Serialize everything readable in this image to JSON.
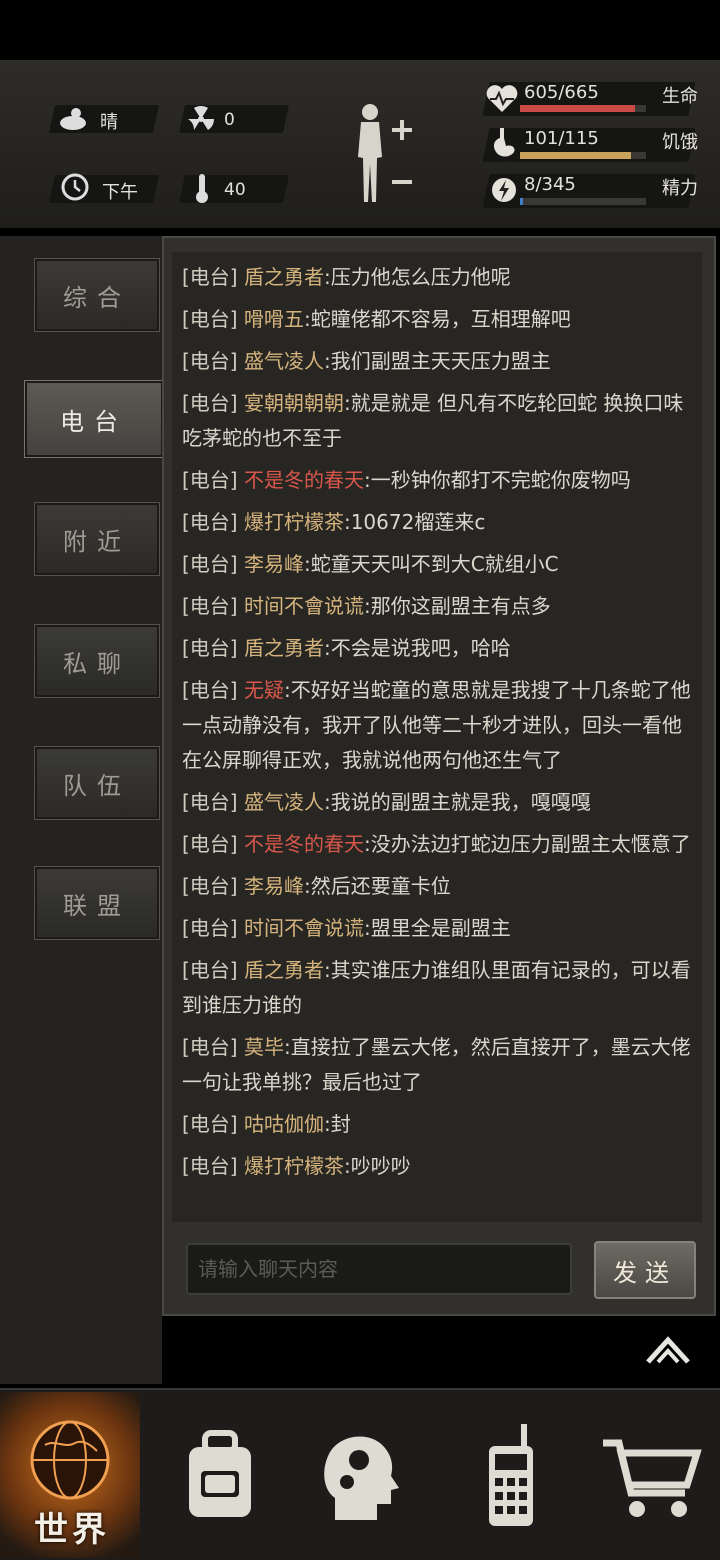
{
  "hud": {
    "weather": "晴",
    "radiation": "0",
    "time_of_day": "下午",
    "temperature": "40",
    "health": {
      "label": "生命",
      "value": "605/665",
      "fraction": 0.91,
      "color": "#c84a45"
    },
    "hunger": {
      "label": "饥饿",
      "value": "101/115",
      "fraction": 0.88,
      "color": "#c9a25b"
    },
    "energy": {
      "label": "精力",
      "value": "8/345",
      "fraction": 0.02,
      "color": "#3f7fcf"
    }
  },
  "tabs": [
    {
      "label": "综合",
      "active": false
    },
    {
      "label": "电台",
      "active": true
    },
    {
      "label": "附近",
      "active": false
    },
    {
      "label": "私聊",
      "active": false
    },
    {
      "label": "队伍",
      "active": false
    },
    {
      "label": "联盟",
      "active": false
    }
  ],
  "messages": [
    {
      "channel": "[电台]",
      "name": "盾之勇者",
      "text": ":压力他怎么压力他呢",
      "red": false
    },
    {
      "channel": "[电台]",
      "name": "嗗嗗五",
      "text": ":蛇瞳佬都不容易，互相理解吧",
      "red": false
    },
    {
      "channel": "[电台]",
      "name": "盛气凌人",
      "text": ":我们副盟主天天压力盟主",
      "red": false
    },
    {
      "channel": "[电台]",
      "name": "宴朝朝朝朝",
      "text": ":就是就是 但凡有不吃轮回蛇 换换口味吃茅蛇的也不至于",
      "red": false
    },
    {
      "channel": "[电台]",
      "name": "不是冬的春天",
      "text": ":一秒钟你都打不完蛇你废物吗",
      "red": true
    },
    {
      "channel": "[电台]",
      "name": "爆打柠檬茶",
      "text": ":10672榴莲来c",
      "red": false
    },
    {
      "channel": "[电台]",
      "name": "李易峰",
      "text": ":蛇童天天叫不到大C就组小C",
      "red": false
    },
    {
      "channel": "[电台]",
      "name": "时间不會说谎",
      "text": ":那你这副盟主有点多",
      "red": false
    },
    {
      "channel": "[电台]",
      "name": "盾之勇者",
      "text": ":不会是说我吧，哈哈",
      "red": false
    },
    {
      "channel": "[电台]",
      "name": "无疑",
      "text": ":不好好当蛇童的意思就是我搜了十几条蛇了他一点动静没有，我开了队他等二十秒才进队，回头一看他在公屏聊得正欢，我就说他两句他还生气了",
      "red": true
    },
    {
      "channel": "[电台]",
      "name": "盛气凌人",
      "text": ":我说的副盟主就是我，嘎嘎嘎",
      "red": false
    },
    {
      "channel": "[电台]",
      "name": "不是冬的春天",
      "text": ":没办法边打蛇边压力副盟主太惬意了",
      "red": true
    },
    {
      "channel": "[电台]",
      "name": "李易峰",
      "text": ":然后还要童卡位",
      "red": false
    },
    {
      "channel": "[电台]",
      "name": "时间不會说谎",
      "text": ":盟里全是副盟主",
      "red": false
    },
    {
      "channel": "[电台]",
      "name": "盾之勇者",
      "text": ":其实谁压力谁组队里面有记录的，可以看到谁压力谁的",
      "red": false
    },
    {
      "channel": "[电台]",
      "name": "莫毕",
      "text": ":直接拉了墨云大佬，然后直接开了，墨云大佬一句让我单挑？最后也过了",
      "red": false
    },
    {
      "channel": "[电台]",
      "name": "咕咕伽伽",
      "text": ":封",
      "red": false
    },
    {
      "channel": "[电台]",
      "name": "爆打柠檬茶",
      "text": ":吵吵吵",
      "red": false
    }
  ],
  "input": {
    "placeholder": "请输入聊天内容"
  },
  "send_label": "发送",
  "bottom_nav": {
    "world_label": "世界"
  }
}
